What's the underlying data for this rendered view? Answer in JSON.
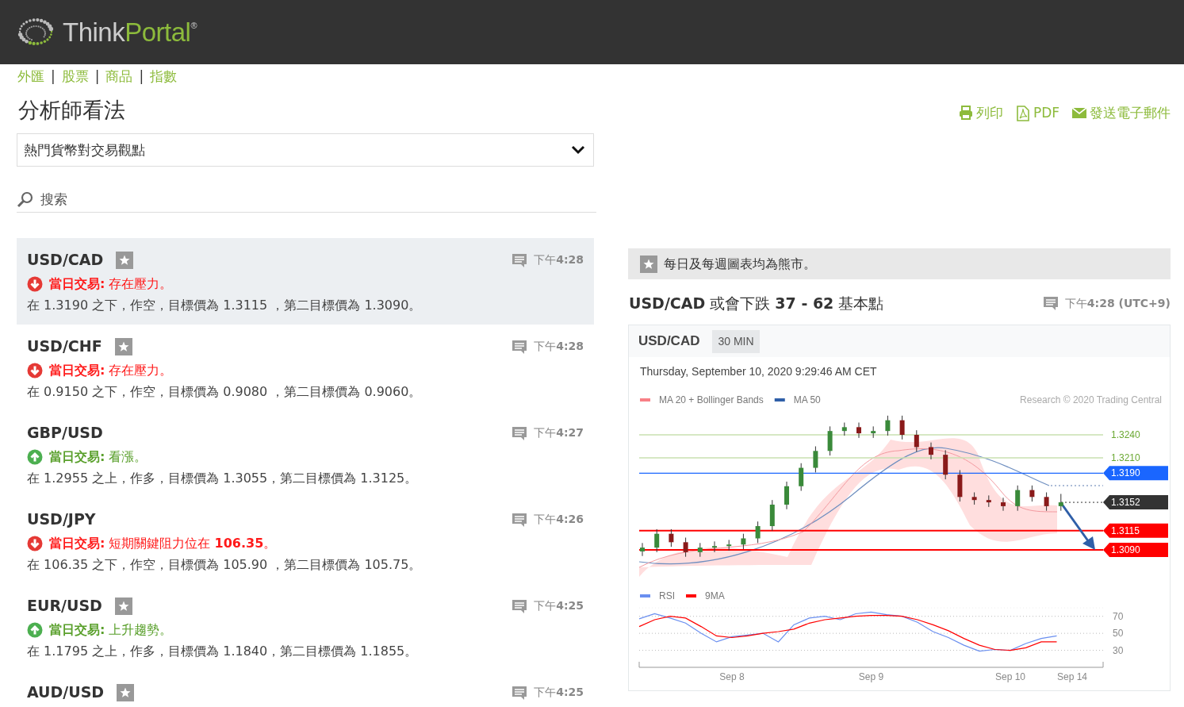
{
  "logo": {
    "part_1": "Think",
    "part_2": "Portal",
    "mark": "®"
  },
  "nav": {
    "separator": "|",
    "links": [
      "外匯",
      "股票",
      "商品",
      "指數"
    ]
  },
  "page_title": "分析師看法",
  "actions": [
    {
      "kind": "print",
      "label": "列印"
    },
    {
      "kind": "pdf",
      "label": "PDF"
    },
    {
      "kind": "email",
      "label": "發送電子郵件"
    }
  ],
  "category_select": {
    "value": "熱門貨幣對交易觀點"
  },
  "search": {
    "placeholder": "搜索"
  },
  "ideas": [
    {
      "pair": "USD/CAD",
      "starred": true,
      "kind": "down",
      "headline": "**當日交易:** 存在壓力。",
      "description": "在 1.3190 之下，作空，目標價為 1.3115 ，第二目標價為 1.3090。",
      "time": "下午**4:28**",
      "selected": true
    },
    {
      "pair": "USD/CHF",
      "starred": true,
      "kind": "down",
      "headline": "**當日交易:** 存在壓力。",
      "description": "在 0.9150 之下，作空，目標價為 0.9080 ，第二目標價為 0.9060。",
      "time": "下午**4:28**",
      "selected": false
    },
    {
      "pair": "GBP/USD",
      "starred": false,
      "kind": "up",
      "headline": "**當日交易:** 看漲。",
      "description": "在 1.2955 之上，作多，目標價為 1.3055，第二目標價為 1.3125。",
      "time": "下午**4:27**",
      "selected": false
    },
    {
      "pair": "USD/JPY",
      "starred": false,
      "kind": "down",
      "headline": "**當日交易:** 短期關鍵阻力位在 **106.35**。",
      "description": "在 106.35 之下，作空，目標價為 105.90 ，第二目標價為 105.75。",
      "time": "下午**4:26**",
      "selected": false
    },
    {
      "pair": "EUR/USD",
      "starred": true,
      "kind": "up",
      "headline": "**當日交易:** 上升趨勢。",
      "description": "在 1.1795 之上，作多，目標價為 1.1840，第二目標價為 1.1855。",
      "time": "下午**4:25**",
      "selected": false
    },
    {
      "pair": "AUD/USD",
      "starred": true,
      "time": "下午**4:25**",
      "selected": false
    }
  ],
  "detail": {
    "banner": "每日及每週圖表均為熊市。",
    "starred": true,
    "title": "**USD/CAD** 或會下跌 **37 - 62** 基本點",
    "time": "下午**4:28 (UTC+9)**",
    "chart": {
      "symbol": "USD/CAD",
      "interval": "30 MIN",
      "date": "Thursday, September 10, 2020 9:29:46 AM CET",
      "legend": [
        {
          "label": "MA 20 + Bollinger Bands",
          "color": "#f87f86"
        },
        {
          "label": "MA 50",
          "color": "#2f5fa8"
        }
      ],
      "credit": "Research © 2020 Trading Central",
      "levels": [
        {
          "kind": "text",
          "color": "#6aa832"
        },
        {
          "kind": "text",
          "color": "#6aa832"
        },
        {
          "kind": "tag",
          "color": "#1a66ff"
        },
        {
          "kind": "tag",
          "color": "#333333"
        },
        {
          "kind": "tag",
          "color": "#ff0000"
        },
        {
          "kind": "tag",
          "color": "#ff0000"
        }
      ],
      "candles": {
        "chart_data": {
          "type": "candlestick",
          "ylim": [
            1.309,
            1.324
          ],
          "yticks": [
            {
              "value": 1.324,
              "label": "1.3240"
            },
            {
              "value": 1.321,
              "label": "1.3210"
            },
            {
              "value": 1.319,
              "label": "1.3190"
            },
            1.3152,
            1.3115,
            {
              "value": 1.309,
              "label": "1.3090"
            }
          ],
          "categories": [
            null,
            null,
            null,
            null,
            null,
            null,
            null,
            null,
            null,
            null,
            null,
            null,
            null,
            null,
            null,
            null,
            null,
            null,
            null,
            null,
            null,
            null,
            null,
            null,
            null,
            null,
            null,
            null,
            null,
            null
          ],
          "ohlc": [
            [
              1.3088,
              1.3099,
              1.3082,
              1.3093
            ],
            [
              1.3093,
              1.3117,
              1.3087,
              1.3111
            ],
            [
              1.3111,
              1.3117,
              1.3094,
              1.31
            ],
            [
              1.31,
              1.3106,
              1.3081,
              1.3087
            ],
            [
              1.3087,
              1.3099,
              1.3081,
              1.3093
            ],
            [
              1.3093,
              1.3101,
              1.3087,
              1.3095
            ],
            [
              1.3095,
              1.3103,
              1.3089,
              1.3097
            ],
            [
              1.3097,
              1.3111,
              1.3091,
              1.3105
            ],
            [
              1.3105,
              1.3127,
              1.3099,
              1.3121
            ],
            [
              1.3121,
              1.3155,
              1.3115,
              1.3149
            ],
            [
              1.3149,
              1.3179,
              1.3143,
              1.3173
            ],
            [
              1.3173,
              1.3203,
              1.3167,
              1.3197
            ],
            [
              1.3197,
              1.3225,
              1.3191,
              1.3219
            ],
            [
              1.3219,
              1.3251,
              1.3213,
              1.3245
            ],
            [
              1.3245,
              1.3256,
              1.3239,
              1.325
            ],
            [
              1.325,
              1.3256,
              1.3236,
              1.3242
            ],
            [
              1.3242,
              1.3251,
              1.3236,
              1.3245
            ],
            [
              1.3245,
              1.3265,
              1.3239,
              1.3259
            ],
            [
              1.3259,
              1.3265,
              1.3234,
              1.324
            ],
            [
              1.324,
              1.3246,
              1.3218,
              1.3224
            ],
            [
              1.3224,
              1.323,
              1.3208,
              1.3214
            ],
            [
              1.3214,
              1.322,
              1.3182,
              1.3188
            ],
            [
              1.3188,
              1.3194,
              1.3153,
              1.3159
            ],
            [
              1.3159,
              1.3165,
              1.3149,
              1.3155
            ],
            [
              1.3155,
              1.3161,
              1.3146,
              1.3152
            ],
            [
              1.3152,
              1.3158,
              1.3141,
              1.3147
            ],
            [
              1.3147,
              1.3174,
              1.3141,
              1.3168
            ],
            [
              1.3168,
              1.3174,
              1.3153,
              1.3159
            ],
            [
              1.3159,
              1.3165,
              1.3141,
              1.3147
            ],
            [
              1.3147,
              1.3163,
              1.3141,
              1.3152
            ]
          ]
        }
      },
      "rsi": {
        "chart_data": {
          "type": "line",
          "ylim": [
            10,
            80
          ],
          "yticks": [
            70,
            50,
            30
          ],
          "grid": true,
          "legend": "upper left",
          "categories": [
            null,
            null,
            null,
            null,
            null,
            null,
            "Sep 8",
            null,
            null,
            null,
            null,
            null,
            null,
            null,
            null,
            "Sep 9",
            null,
            null,
            null,
            null,
            null,
            null,
            null,
            null,
            "Sep 10",
            null,
            null,
            null,
            "Sep 14",
            null
          ],
          "series": [
            {
              "name": "RSI",
              "color": "#6a8ff0",
              "values": [
                67,
                73,
                68,
                62,
                50,
                40,
                46,
                48,
                50,
                40,
                60,
                68,
                70,
                66,
                73,
                75,
                72,
                70,
                63,
                52,
                45,
                36,
                29,
                31,
                30,
                38,
                44,
                47,
                null,
                null
              ]
            },
            {
              "name": "9MA",
              "color": "#ff0000",
              "values": [
                58,
                66,
                70,
                68,
                58,
                47,
                45,
                47,
                50,
                52,
                55,
                62,
                66,
                68,
                70,
                71,
                71,
                70,
                66,
                60,
                53,
                44,
                36,
                31,
                30,
                33,
                40,
                40,
                null,
                null
              ]
            }
          ]
        }
      }
    }
  }
}
